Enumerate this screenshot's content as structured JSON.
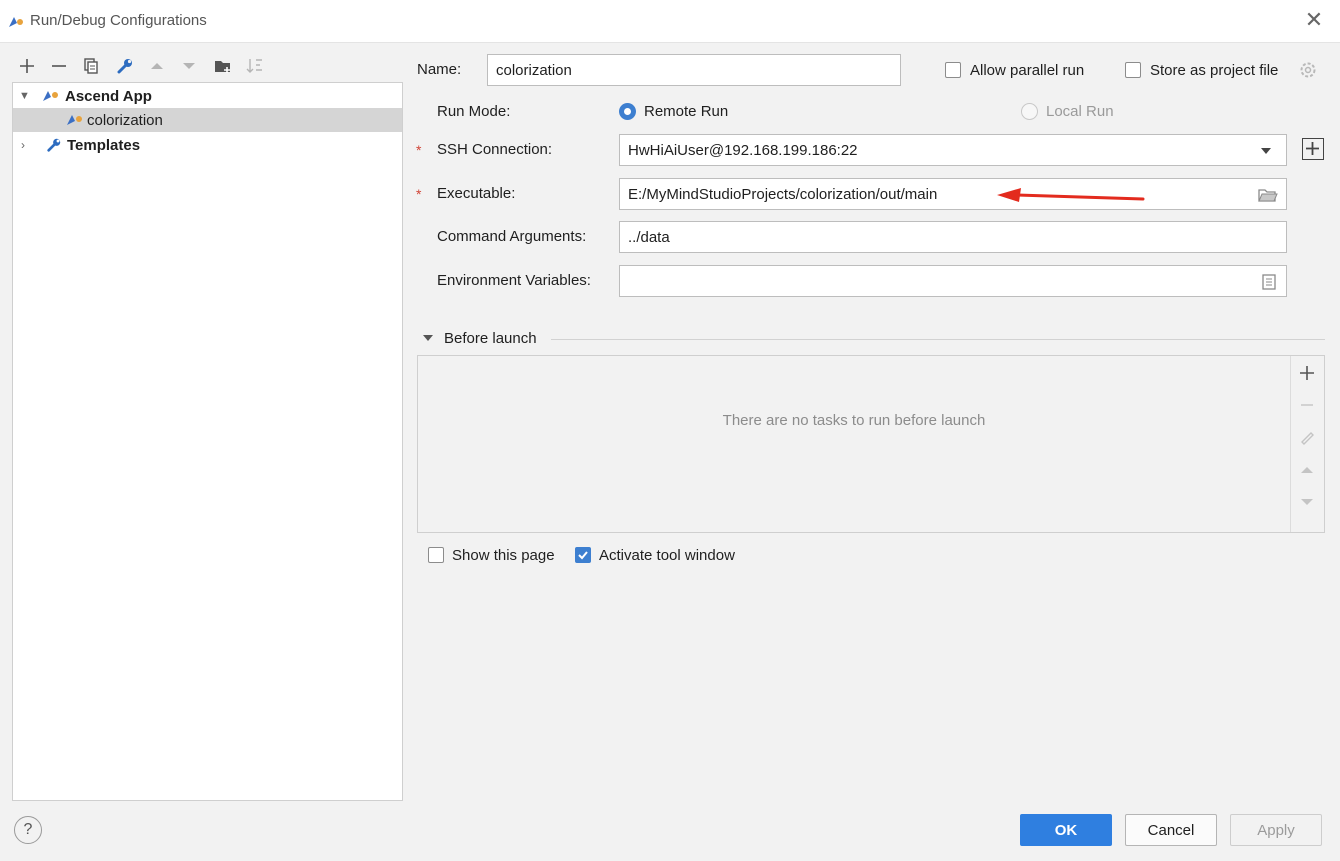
{
  "window": {
    "title": "Run/Debug Configurations"
  },
  "tree": {
    "items": [
      {
        "label": "Ascend App"
      },
      {
        "label": "colorization"
      },
      {
        "label": "Templates"
      }
    ]
  },
  "form": {
    "name_label": "Name:",
    "name_value": "colorization",
    "allow_parallel_label": "Allow parallel run",
    "store_project_label": "Store as project file",
    "run_mode_label": "Run Mode:",
    "remote_run_label": "Remote Run",
    "local_run_label": "Local Run",
    "ssh_label": "SSH Connection:",
    "ssh_value": "HwHiAiUser@192.168.199.186:22",
    "exec_label": "Executable:",
    "exec_value": "E:/MyMindStudioProjects/colorization/out/main",
    "args_label": "Command Arguments:",
    "args_value": "../data",
    "env_label": "Environment Variables:",
    "env_value": "",
    "required_marker": "*"
  },
  "before_launch": {
    "title": "Before launch",
    "empty_text": "There are no tasks to run before launch"
  },
  "options": {
    "show_page_label": "Show this page",
    "activate_tool_label": "Activate tool window"
  },
  "footer": {
    "help_label": "?",
    "ok_label": "OK",
    "cancel_label": "Cancel",
    "apply_label": "Apply"
  },
  "colors": {
    "accent": "#3d7fd0",
    "required": "#d04437",
    "annotation_arrow": "#e32b1e"
  }
}
